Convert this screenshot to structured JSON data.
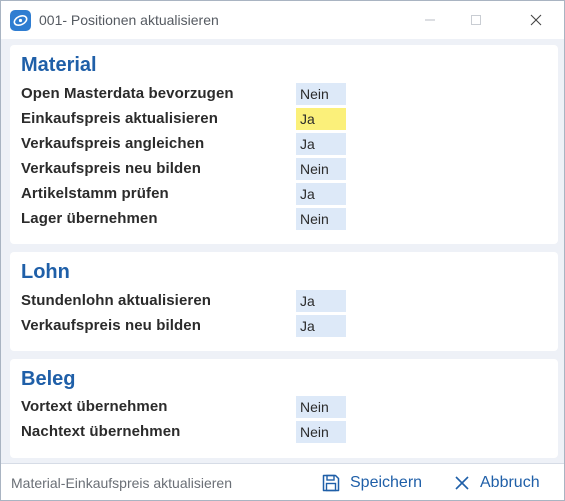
{
  "window": {
    "title": "001- Positionen aktualisieren",
    "icon": "app-logo-icon",
    "controls": [
      "minimize-icon",
      "maximize-icon",
      "close-icon"
    ]
  },
  "sections": {
    "material": {
      "title": "Material",
      "rows": [
        {
          "label": "Open Masterdata bevorzugen",
          "value": "Nein"
        },
        {
          "label": "Einkaufspreis aktualisieren",
          "value": "Ja",
          "highlighted": true
        },
        {
          "label": "Verkaufspreis angleichen",
          "value": "Ja"
        },
        {
          "label": "Verkaufspreis neu bilden",
          "value": "Nein"
        },
        {
          "label": "Artikelstamm prüfen",
          "value": "Ja"
        },
        {
          "label": "Lager übernehmen",
          "value": "Nein"
        }
      ]
    },
    "lohn": {
      "title": "Lohn",
      "rows": [
        {
          "label": "Stundenlohn aktualisieren",
          "value": "Ja"
        },
        {
          "label": "Verkaufspreis neu bilden",
          "value": "Ja"
        }
      ]
    },
    "beleg": {
      "title": "Beleg",
      "rows": [
        {
          "label": "Vortext übernehmen",
          "value": "Nein"
        },
        {
          "label": "Nachtext übernehmen",
          "value": "Nein"
        }
      ]
    }
  },
  "footer": {
    "status": "Material-Einkaufspreis aktualisieren",
    "save_label": "Speichern",
    "save_icon": "save-icon",
    "cancel_label": "Abbruch",
    "cancel_icon": "close-icon"
  },
  "colors": {
    "accent": "#1f5fa8",
    "value_bg": "#dde9f8",
    "highlight_bg": "#fbf07a",
    "window_bg": "#eef1f7"
  }
}
